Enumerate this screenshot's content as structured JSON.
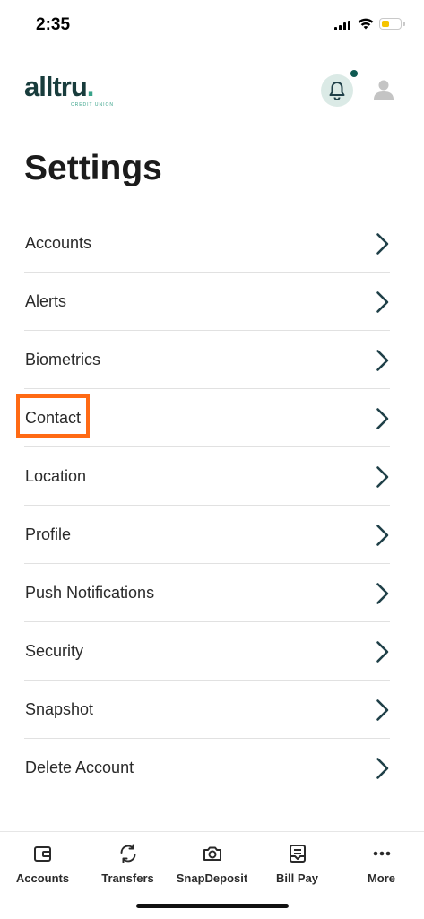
{
  "status_bar": {
    "time": "2:35"
  },
  "header": {
    "logo_text": "alltru",
    "logo_dot": ".",
    "logo_subtitle": "CREDIT UNION",
    "notification_icon": "bell-icon",
    "profile_icon": "person-icon"
  },
  "page": {
    "title": "Settings"
  },
  "settings": {
    "items": [
      {
        "label": "Accounts"
      },
      {
        "label": "Alerts"
      },
      {
        "label": "Biometrics"
      },
      {
        "label": "Contact"
      },
      {
        "label": "Location"
      },
      {
        "label": "Profile"
      },
      {
        "label": "Push Notifications"
      },
      {
        "label": "Security"
      },
      {
        "label": "Snapshot"
      },
      {
        "label": "Delete Account"
      }
    ],
    "highlighted_item": "Contact"
  },
  "tab_bar": {
    "tabs": [
      {
        "label": "Accounts",
        "icon": "wallet-icon"
      },
      {
        "label": "Transfers",
        "icon": "transfer-icon"
      },
      {
        "label": "SnapDeposit",
        "icon": "camera-icon"
      },
      {
        "label": "Bill Pay",
        "icon": "bill-icon"
      },
      {
        "label": "More",
        "icon": "more-icon"
      }
    ]
  },
  "colors": {
    "brand_dark": "#183c3c",
    "brand_accent": "#3aa38a",
    "highlight": "#ff6a14",
    "chevron": "#1f4048"
  }
}
